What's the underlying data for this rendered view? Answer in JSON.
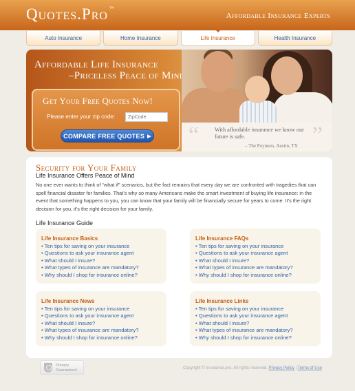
{
  "header": {
    "logo": "Quotes.Pro",
    "logo_tm": "™",
    "tagline": "Affordable Insurance Experts"
  },
  "nav": {
    "tabs": [
      {
        "label": "Auto Insurance"
      },
      {
        "label": "Home Insurance"
      },
      {
        "label": "Life Insurance"
      },
      {
        "label": "Health Insurance"
      }
    ]
  },
  "hero": {
    "title_line1": "Affordable Life Insurance",
    "title_line2": "–Priceless Peace of Mind."
  },
  "quote_form": {
    "title": "Get Your Free Quotes Now!",
    "zip_label": "Please enter your zip code:",
    "zip_placeholder": "ZipCode",
    "button_label": "COMPARE FREE QUOTES"
  },
  "testimonial": {
    "text": "With affordable insurance we know our future is safe.",
    "cite": "– The Poynters, Austin, TX"
  },
  "main": {
    "title": "Security for Your Family",
    "subtitle": "Life Insurance Offers Peace of Mind",
    "body": "No one ever wants to think of “what if” scenarios, but the fact remains that every day we are confronted with tragedies that can spell financial disaster for families. That’s why so many Americans make the smart investment of buying life insurance: in the event that something happens to you, you can know that your family will be financially secure for years to come. It’s the right decision for you, it’s the right decision for your family.",
    "guide_title": "Life Insurance Guide"
  },
  "cards": [
    {
      "title": "Life Insurance Basics",
      "links": [
        "Ten tips for saving on your insurance",
        "Questions to ask your insurance agent",
        "What should I insure?",
        "What types of insurance are mandatory?",
        "Why should I shop for insurance online?"
      ]
    },
    {
      "title": "Life Insurance FAQs",
      "links": [
        "Ten tips for saving on your insurance",
        "Questions to ask your insurance agent",
        "What should I insure?",
        "What types of insurance are mandatory?",
        "Why should I shop for insurance online?"
      ]
    },
    {
      "title": "Life Insurance News",
      "links": [
        "Ten tips for saving on your insurance",
        "Questions to ask your insurance agent",
        "What should I insure?",
        "What types of insurance are mandatory?",
        "Why should I shop for insurance online?"
      ]
    },
    {
      "title": "Life Insurance Links",
      "links": [
        "Ten tips for saving on your insurance",
        "Questions to ask your insurance agent",
        "What should I insure?",
        "What types of insurance are mandatory?",
        "Why should I shop for insurance online?"
      ]
    }
  ],
  "footer": {
    "privacy_line1": "Privacy",
    "privacy_line2": "Guaranteed",
    "copyright": "Copyright © Insurance.pro. All rights reserved.",
    "privacy_link": "Privacy Policy",
    "terms_link": "Terms of Use"
  },
  "colors": {
    "brand_orange": "#c8651a",
    "link_blue": "#2f5fa8",
    "heading_orange": "#c45e14"
  }
}
